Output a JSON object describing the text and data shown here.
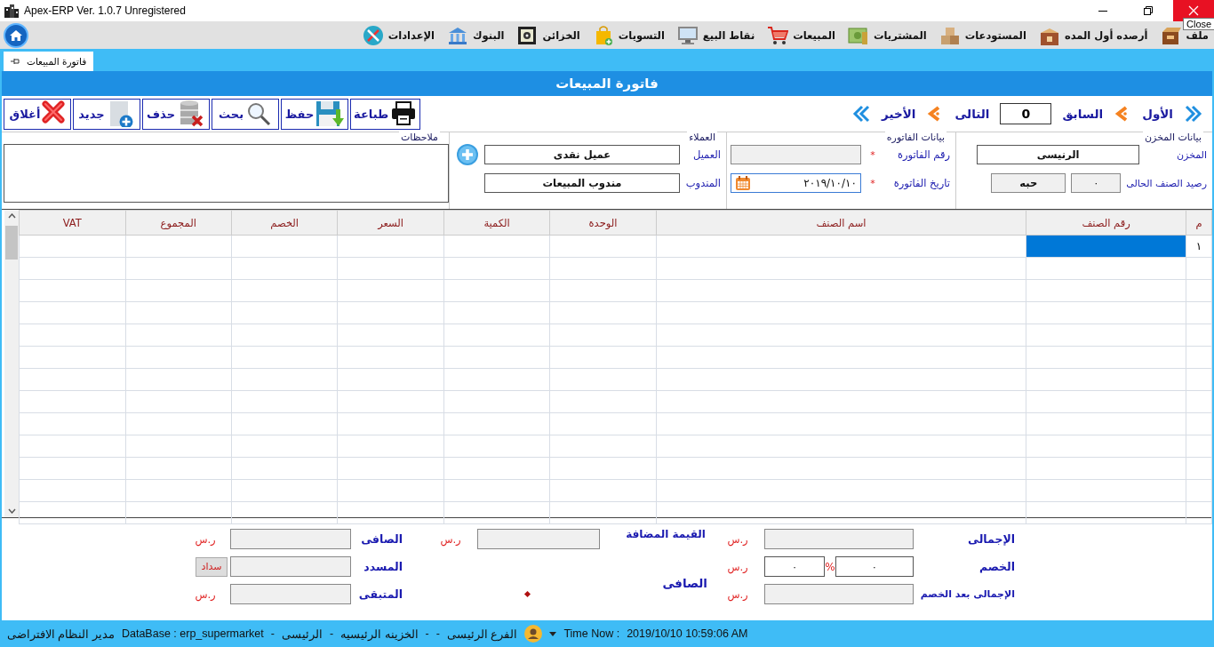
{
  "window": {
    "title": "Apex-ERP Ver. 1.0.7 Unregistered",
    "tooltip": "Close"
  },
  "menu": [
    {
      "label": "ملف"
    },
    {
      "label": "أرصده أول المده"
    },
    {
      "label": "المستودعات"
    },
    {
      "label": "المشتريات"
    },
    {
      "label": "المبيعات"
    },
    {
      "label": "نقاط البيع"
    },
    {
      "label": "التسويات"
    },
    {
      "label": "الخزائن"
    },
    {
      "label": "البنوك"
    },
    {
      "label": "الإعدادات"
    }
  ],
  "tabs": [
    {
      "label": "فاتورة المبيعات",
      "selected": true
    }
  ],
  "form_title": "فاتورة المبيعات",
  "navigation": [
    {
      "kind": "first",
      "label": "الأول"
    },
    {
      "kind": "prev",
      "label": "السابق"
    },
    {
      "kind": "counter",
      "value": "0"
    },
    {
      "kind": "next",
      "label": "التالى"
    },
    {
      "kind": "last",
      "label": "الأخير"
    }
  ],
  "toolbar": [
    {
      "label": "طباعة"
    },
    {
      "label": "حفظ"
    },
    {
      "label": "بحث"
    },
    {
      "label": "حذف"
    },
    {
      "label": "جديد"
    },
    {
      "label": "أغلاق"
    }
  ],
  "store_panel": {
    "legend": "بيانات المخزن",
    "warehouse": {
      "label": "المخزن",
      "value": "الرنيسى",
      "readonly": false
    },
    "balance": {
      "label": "رصيد الصنف الحالى",
      "quantity": "٠",
      "unit": "حبه",
      "readonly": true
    }
  },
  "invoice_panel": {
    "legend": "بيانات الفاتوره",
    "number": {
      "label": "رقم الفاتورة",
      "required_mark": "*",
      "readonly": true
    },
    "date": {
      "label": "تاريخ الفاتورة",
      "required_mark": "*",
      "value": "٢٠١٩/١٠/١٠",
      "readonly": false
    }
  },
  "customers_panel": {
    "legend": "العملاء",
    "customer": {
      "label": "العميل",
      "value": "عميل نقدى"
    },
    "salesman": {
      "label": "المندوب",
      "value": "مندوب المبيعات"
    }
  },
  "notes_panel": {
    "legend": "ملاحظات"
  },
  "table": {
    "columns": [
      "م",
      "رقم الصنف",
      "اسم الصنف",
      "الوحدة",
      "الكمية",
      "السعر",
      "الخصم",
      "المجموع",
      "VAT"
    ],
    "rows": [
      {
        "number": "١",
        "selected": true
      }
    ]
  },
  "summary": {
    "gross": {
      "label": "الإجمالى",
      "currency": "ر.س",
      "readonly": true
    },
    "discount": {
      "label": "الخصم",
      "percent": "٠",
      "percent_sign": "%",
      "amount": "٠",
      "currency": "ر.س",
      "readonly": false
    },
    "after_discount": {
      "label": "الإجمالى بعد الخصم",
      "currency": "ر.س",
      "readonly": true
    },
    "vat": {
      "label": "القيمة المضافة",
      "currency": "ر.س",
      "readonly": true
    },
    "net_caption": {
      "label": "الصافى"
    },
    "net": {
      "label": "الصافى",
      "currency": "ر.س",
      "readonly": true
    },
    "paid": {
      "label": "المسدد",
      "button": "سداد",
      "readonly": true
    },
    "remaining": {
      "label": "المتبقى",
      "currency": "ر.س",
      "readonly": true
    }
  },
  "status_bar": [
    {
      "kind": "text",
      "text": "2019/10/10 10:59:06 AM"
    },
    {
      "kind": "text",
      "text": "Time Now :"
    },
    {
      "kind": "caret"
    },
    {
      "kind": "avatar"
    },
    {
      "kind": "text",
      "text": "الفرع الرئيسى"
    },
    {
      "kind": "text",
      "text": "-"
    },
    {
      "kind": "text",
      "text": "-"
    },
    {
      "kind": "text",
      "text": "الخزينه الرئيسيه"
    },
    {
      "kind": "text",
      "text": "-"
    },
    {
      "kind": "text",
      "text": "الرئيسى"
    },
    {
      "kind": "text",
      "text": "-"
    },
    {
      "kind": "text",
      "text": "DataBase : erp_supermarket"
    },
    {
      "kind": "text",
      "text": "مدير النظام الافتراضى"
    }
  ]
}
